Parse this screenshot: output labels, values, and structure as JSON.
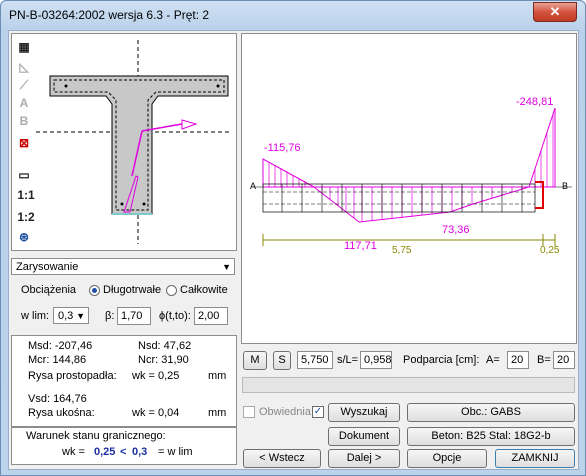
{
  "window": {
    "title": "PN-B-03264:2002 wersja 6.3 - Pręt: 2",
    "close": "✕"
  },
  "toolbar": {
    "scale1": "1:1",
    "scale2": "1:2"
  },
  "mode_combo": {
    "value": "Zarysowanie"
  },
  "loads": {
    "label": "Obciążenia",
    "long_term": "Długotrwałe",
    "total": "Całkowite"
  },
  "params": {
    "wlim_label": "w lim:",
    "wlim_value": "0,3",
    "beta_label": "β:",
    "beta_value": "1,70",
    "phi_label": "ϕ(t,to):",
    "phi_value": "2,00"
  },
  "results": {
    "msd": "Msd: -207,46",
    "nsd": "Nsd: 47,62",
    "mcr": "Mcr: 144,86",
    "ncr": "Ncr: 31,90",
    "rysa_prost": "Rysa prostopadła:",
    "wk1": "wk = 0,25",
    "unit1": "mm",
    "vsd": "Vsd: 164,76",
    "rysa_ukosna": "Rysa ukośna:",
    "wk2": "wk = 0,04",
    "unit2": "mm"
  },
  "condition": {
    "title": "Warunek stanu granicznego:",
    "wk": "wk =",
    "val1": "0,25",
    "lt": "<",
    "val2": "0,3",
    "wlim": "= w lim"
  },
  "diagram": {
    "v1": "-115,76",
    "v2": "-248,81",
    "v3": "117,71",
    "v4": "73,36",
    "len1": "5,75",
    "len2": "0,25",
    "endA": "A",
    "endB": "B"
  },
  "position": {
    "m": "M",
    "s": "S",
    "s_value": "5,750",
    "sl_label": "s/L=",
    "sl_value": "0,958",
    "supports_label": "Podparcia [cm]:",
    "a_label": "A=",
    "a_value": "20",
    "b_label": "B=",
    "b_value": "20"
  },
  "buttons": {
    "obwiednia": "Obwiednia",
    "wyszukaj": "Wyszukaj",
    "obc": "Obc.: GABS",
    "dokument": "Dokument",
    "beton": "Beton: B25   Stal: 18G2-b",
    "wstecz": "< Wstecz",
    "dalej": "Dalej >",
    "opcje": "Opcje",
    "zamknij": "ZAMKNIJ"
  },
  "colors": {
    "diagram": "#e000e0",
    "axis": "#8a8a00",
    "rebar": "#e00000"
  }
}
